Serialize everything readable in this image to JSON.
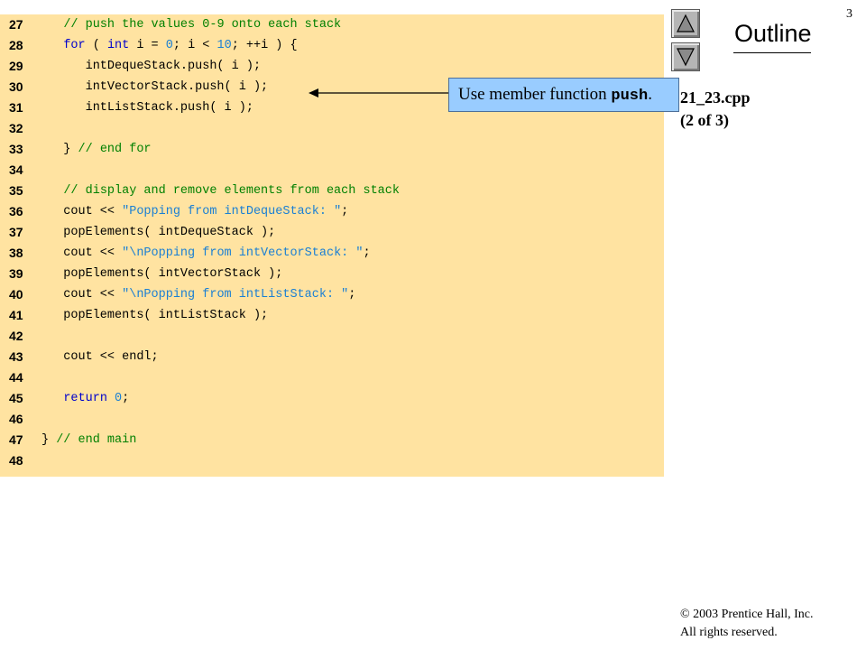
{
  "slide": {
    "page_number": "3",
    "outline_title": "Outline",
    "file_name": "21_23.cpp",
    "part_label": "(2 of 3)",
    "copyright": "© 2003 Prentice Hall, Inc.",
    "rights": "All rights reserved."
  },
  "callout": {
    "text": "Use member function ",
    "code": "push",
    "suffix": "."
  },
  "navigation": {
    "up_icon": "up-triangle-icon",
    "down_icon": "down-triangle-icon"
  },
  "colors": {
    "code_background": "#ffe3a1",
    "callout_background": "#99ccff",
    "comment": "#008000",
    "keyword": "#0000cc",
    "literal": "#1a7fd4"
  },
  "code_lines": [
    {
      "number": "27",
      "tokens": [
        {
          "t": "   "
        },
        {
          "t": "// push the values 0-9 onto each stack",
          "c": "comment"
        }
      ]
    },
    {
      "number": "28",
      "tokens": [
        {
          "t": "   "
        },
        {
          "t": "for",
          "c": "keyword"
        },
        {
          "t": " ( "
        },
        {
          "t": "int",
          "c": "keyword"
        },
        {
          "t": " i = "
        },
        {
          "t": "0",
          "c": "number"
        },
        {
          "t": "; i < "
        },
        {
          "t": "10",
          "c": "number"
        },
        {
          "t": "; ++i ) {"
        }
      ]
    },
    {
      "number": "29",
      "tokens": [
        {
          "t": "      intDequeStack.push( i );"
        }
      ]
    },
    {
      "number": "30",
      "tokens": [
        {
          "t": "      intVectorStack.push( i );"
        }
      ]
    },
    {
      "number": "31",
      "tokens": [
        {
          "t": "      intListStack.push( i );"
        }
      ]
    },
    {
      "number": "32",
      "tokens": []
    },
    {
      "number": "33",
      "tokens": [
        {
          "t": "   } "
        },
        {
          "t": "// end for",
          "c": "comment"
        }
      ]
    },
    {
      "number": "34",
      "tokens": []
    },
    {
      "number": "35",
      "tokens": [
        {
          "t": "   "
        },
        {
          "t": "// display and remove elements from each stack",
          "c": "comment"
        }
      ]
    },
    {
      "number": "36",
      "tokens": [
        {
          "t": "   cout << "
        },
        {
          "t": "\"Popping from intDequeStack: \"",
          "c": "string"
        },
        {
          "t": ";"
        }
      ]
    },
    {
      "number": "37",
      "tokens": [
        {
          "t": "   popElements( intDequeStack );"
        }
      ]
    },
    {
      "number": "38",
      "tokens": [
        {
          "t": "   cout << "
        },
        {
          "t": "\"\\nPopping from intVectorStack: \"",
          "c": "string"
        },
        {
          "t": ";"
        }
      ]
    },
    {
      "number": "39",
      "tokens": [
        {
          "t": "   popElements( intVectorStack );"
        }
      ]
    },
    {
      "number": "40",
      "tokens": [
        {
          "t": "   cout << "
        },
        {
          "t": "\"\\nPopping from intListStack: \"",
          "c": "string"
        },
        {
          "t": ";"
        }
      ]
    },
    {
      "number": "41",
      "tokens": [
        {
          "t": "   popElements( intListStack );"
        }
      ]
    },
    {
      "number": "42",
      "tokens": []
    },
    {
      "number": "43",
      "tokens": [
        {
          "t": "   cout << endl;"
        }
      ]
    },
    {
      "number": "44",
      "tokens": []
    },
    {
      "number": "45",
      "tokens": [
        {
          "t": "   "
        },
        {
          "t": "return",
          "c": "keyword"
        },
        {
          "t": " "
        },
        {
          "t": "0",
          "c": "number"
        },
        {
          "t": ";"
        }
      ]
    },
    {
      "number": "46",
      "tokens": []
    },
    {
      "number": "47",
      "tokens": [
        {
          "t": "} "
        },
        {
          "t": "// end main",
          "c": "comment"
        }
      ]
    },
    {
      "number": "48",
      "tokens": []
    }
  ]
}
